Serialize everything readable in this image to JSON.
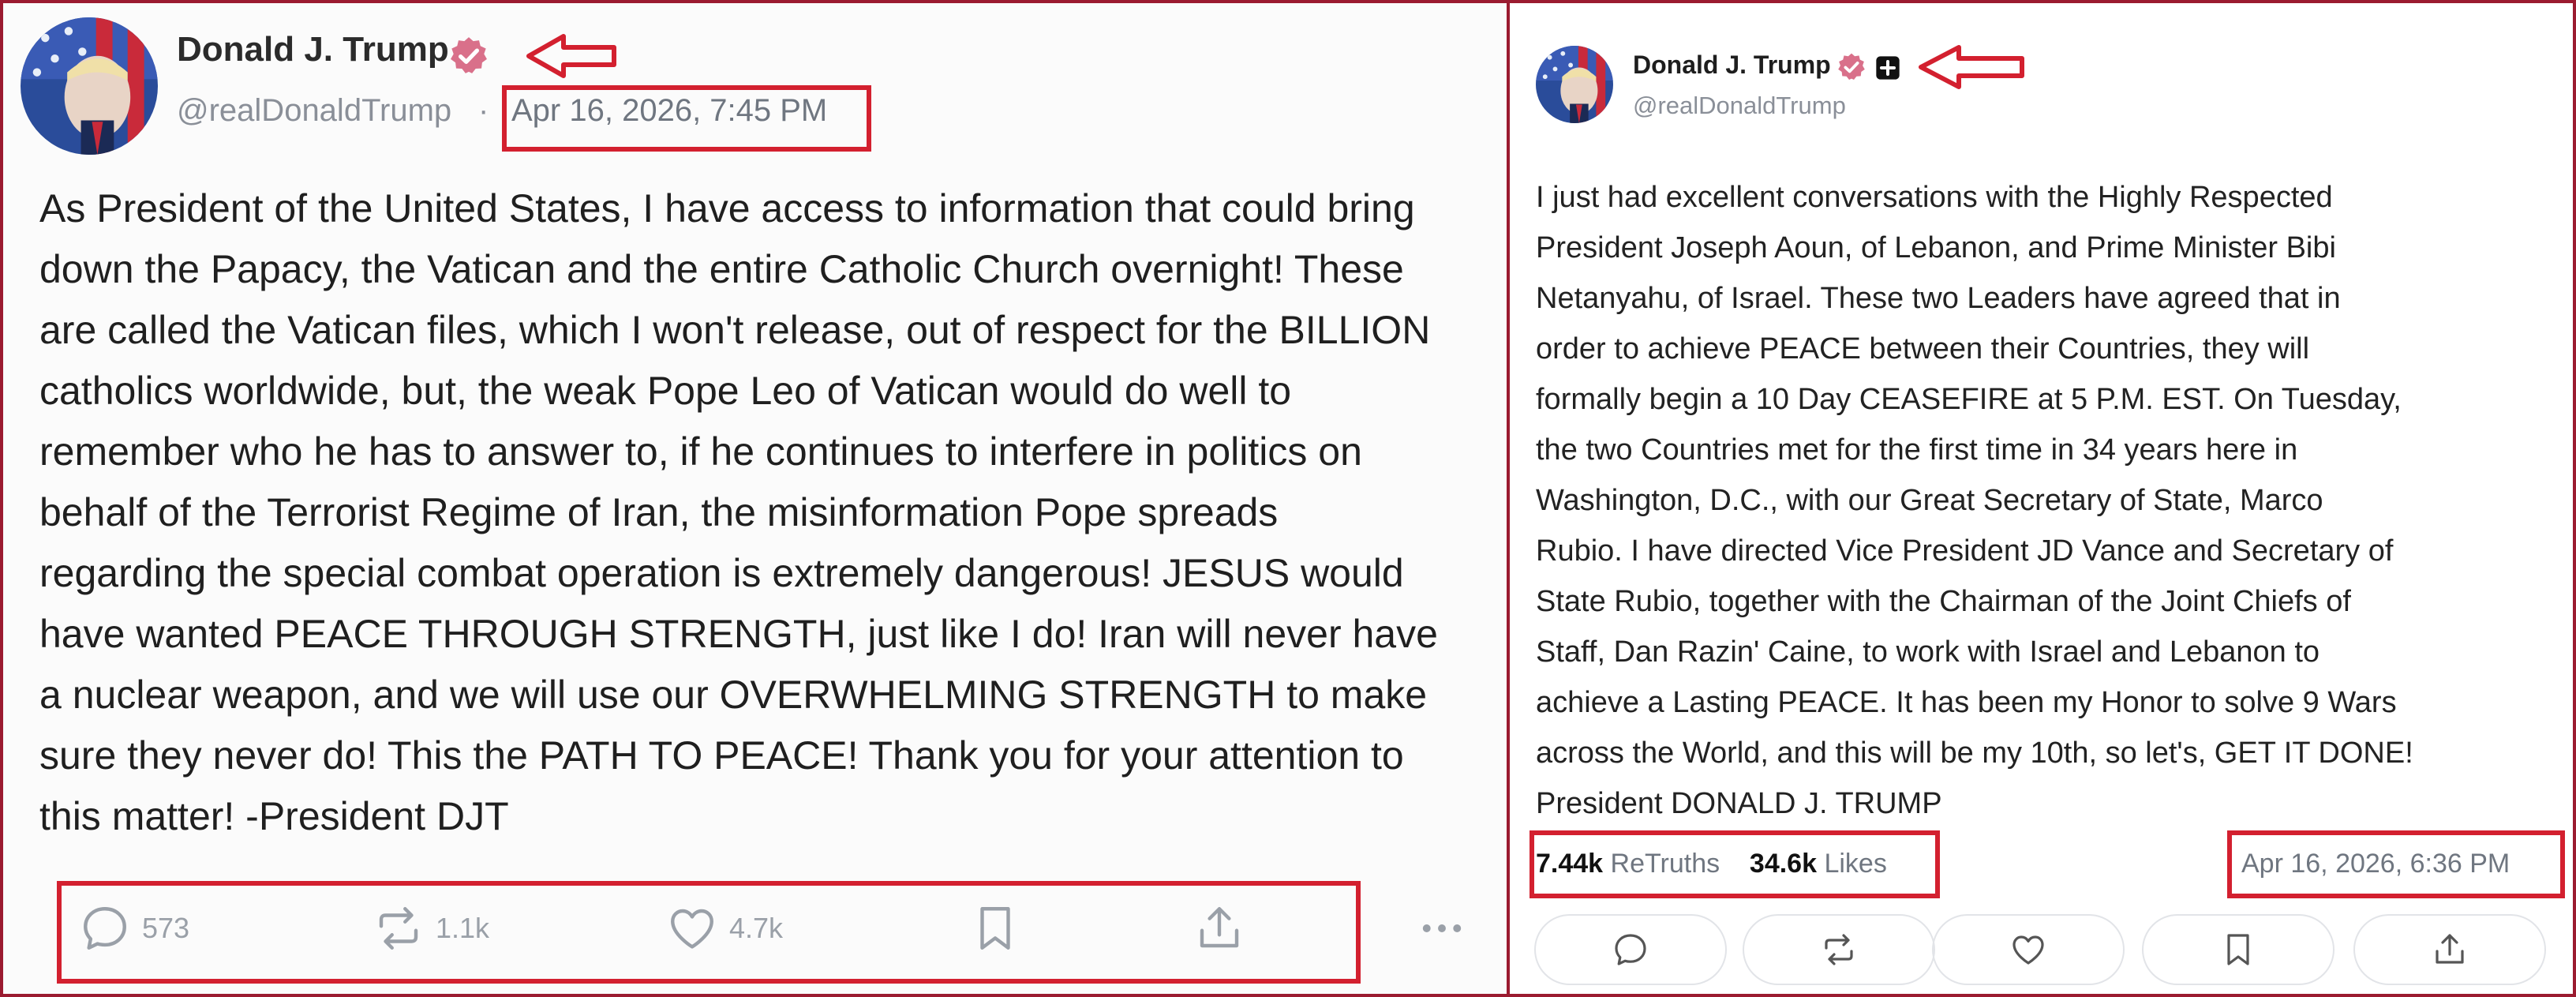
{
  "left_post": {
    "author": {
      "name": "Donald J. Trump",
      "handle": "@realDonaldTrump",
      "separator": "·"
    },
    "timestamp": "Apr 16, 2026, 7:45 PM",
    "body_lines": [
      "As President of the United States, I have access to information that could bring",
      "down the Papacy, the Vatican and the entire Catholic Church overnight! These",
      "are called the Vatican files, which I won't release, out of respect for the BILLION",
      "catholics worldwide, but, the weak Pope Leo of Vatican would do well to",
      "remember who he has to answer to, if he continues to interfere in politics on",
      "behalf of the Terrorist Regime of Iran, the misinformation Pope spreads",
      "regarding the special combat operation is extremely dangerous! JESUS would",
      "have wanted PEACE THROUGH STRENGTH, just like I do! Iran will never have",
      "a nuclear weapon, and we will use our OVERWHELMING STRENGTH to make",
      "sure they never do! This the PATH TO PEACE! Thank you for your attention to",
      "this matter! -President DJT"
    ],
    "actions": {
      "replies": "573",
      "retruths": "1.1k",
      "likes": "4.7k"
    },
    "icons": [
      "verified-badge-icon",
      "reply-icon",
      "retruth-icon",
      "like-icon",
      "bookmark-icon",
      "share-icon",
      "more-icon"
    ]
  },
  "right_post": {
    "author": {
      "name": "Donald J. Trump",
      "handle": "@realDonaldTrump"
    },
    "body_lines": [
      "I just had excellent conversations with the Highly Respected",
      "President Joseph Aoun, of Lebanon, and Prime Minister Bibi",
      "Netanyahu, of Israel. These two Leaders have agreed that in",
      "order to achieve PEACE between their Countries, they will",
      "formally begin a 10 Day CEASEFIRE at 5 P.M. EST. On Tuesday,",
      "the two Countries met for the first time in 34 years here in",
      "Washington, D.C., with our Great Secretary of State, Marco",
      "Rubio. I have directed Vice President JD Vance and Secretary of",
      "State Rubio, together with the Chairman of the Joint Chiefs of",
      "Staff, Dan Razin' Caine, to work with Israel and Lebanon to",
      "achieve a Lasting PEACE. It has been my Honor to solve 9 Wars",
      "across the World, and this will be my 10th, so let's, GET IT DONE!",
      "President DONALD J. TRUMP"
    ],
    "stats": {
      "retruths_count": "7.44k",
      "retruths_label": "ReTruths",
      "likes_count": "34.6k",
      "likes_label": "Likes"
    },
    "timestamp": "Apr 16, 2026, 6:36 PM",
    "icons": [
      "verified-badge-icon",
      "plus-badge-icon",
      "reply-icon",
      "retruth-icon",
      "like-icon",
      "bookmark-icon",
      "share-icon"
    ]
  },
  "colors": {
    "annotation_red": "#d3202f",
    "frame_maroon": "#9b1b30",
    "verified_pink": "#d9708a",
    "muted_gray": "#8a8f98"
  }
}
